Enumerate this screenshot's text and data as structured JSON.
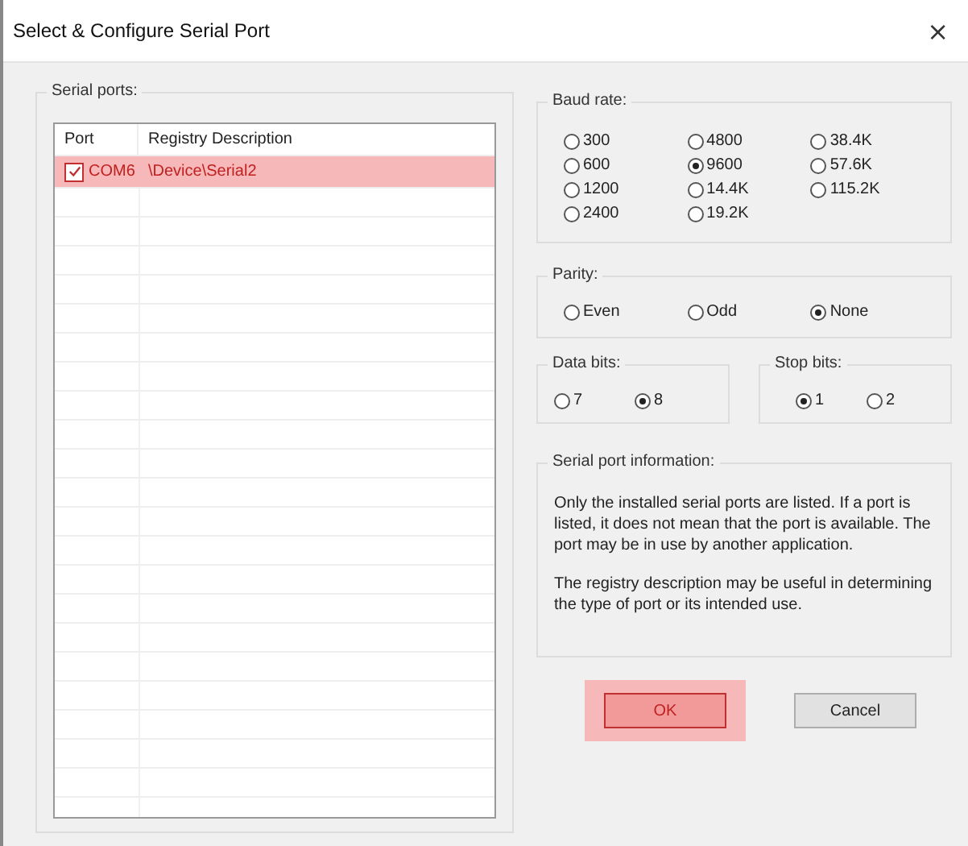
{
  "window": {
    "title": "Select & Configure Serial Port",
    "close": "×"
  },
  "serial_ports": {
    "label": "Serial ports:",
    "columns": [
      "Port",
      "Registry Description"
    ],
    "rows": [
      {
        "port": "COM6",
        "description": "\\Device\\Serial2",
        "checked": true,
        "highlighted": true
      }
    ]
  },
  "baud_rate": {
    "label": "Baud rate:",
    "options": [
      {
        "label": "300",
        "selected": false
      },
      {
        "label": "600",
        "selected": false
      },
      {
        "label": "1200",
        "selected": false
      },
      {
        "label": "2400",
        "selected": false
      },
      {
        "label": "4800",
        "selected": false
      },
      {
        "label": "9600",
        "selected": true
      },
      {
        "label": "14.4K",
        "selected": false
      },
      {
        "label": "19.2K",
        "selected": false
      },
      {
        "label": "38.4K",
        "selected": false
      },
      {
        "label": "57.6K",
        "selected": false
      },
      {
        "label": "115.2K",
        "selected": false
      }
    ]
  },
  "parity": {
    "label": "Parity:",
    "options": [
      {
        "label": "Even",
        "selected": false
      },
      {
        "label": "Odd",
        "selected": false
      },
      {
        "label": "None",
        "selected": true
      }
    ]
  },
  "data_bits": {
    "label": "Data bits:",
    "options": [
      {
        "label": "7",
        "selected": false
      },
      {
        "label": "8",
        "selected": true
      }
    ]
  },
  "stop_bits": {
    "label": "Stop bits:",
    "options": [
      {
        "label": "1",
        "selected": true
      },
      {
        "label": "2",
        "selected": false
      }
    ]
  },
  "info": {
    "label": "Serial port information:",
    "paragraphs": [
      "Only the installed serial ports are listed.  If a port is listed, it does not mean that the port is available.  The port may be in use by another application.",
      "The registry description may be useful in determining the type of port or its intended use."
    ]
  },
  "buttons": [
    {
      "label": "OK",
      "highlighted": true
    },
    {
      "label": "Cancel",
      "highlighted": false
    }
  ]
}
